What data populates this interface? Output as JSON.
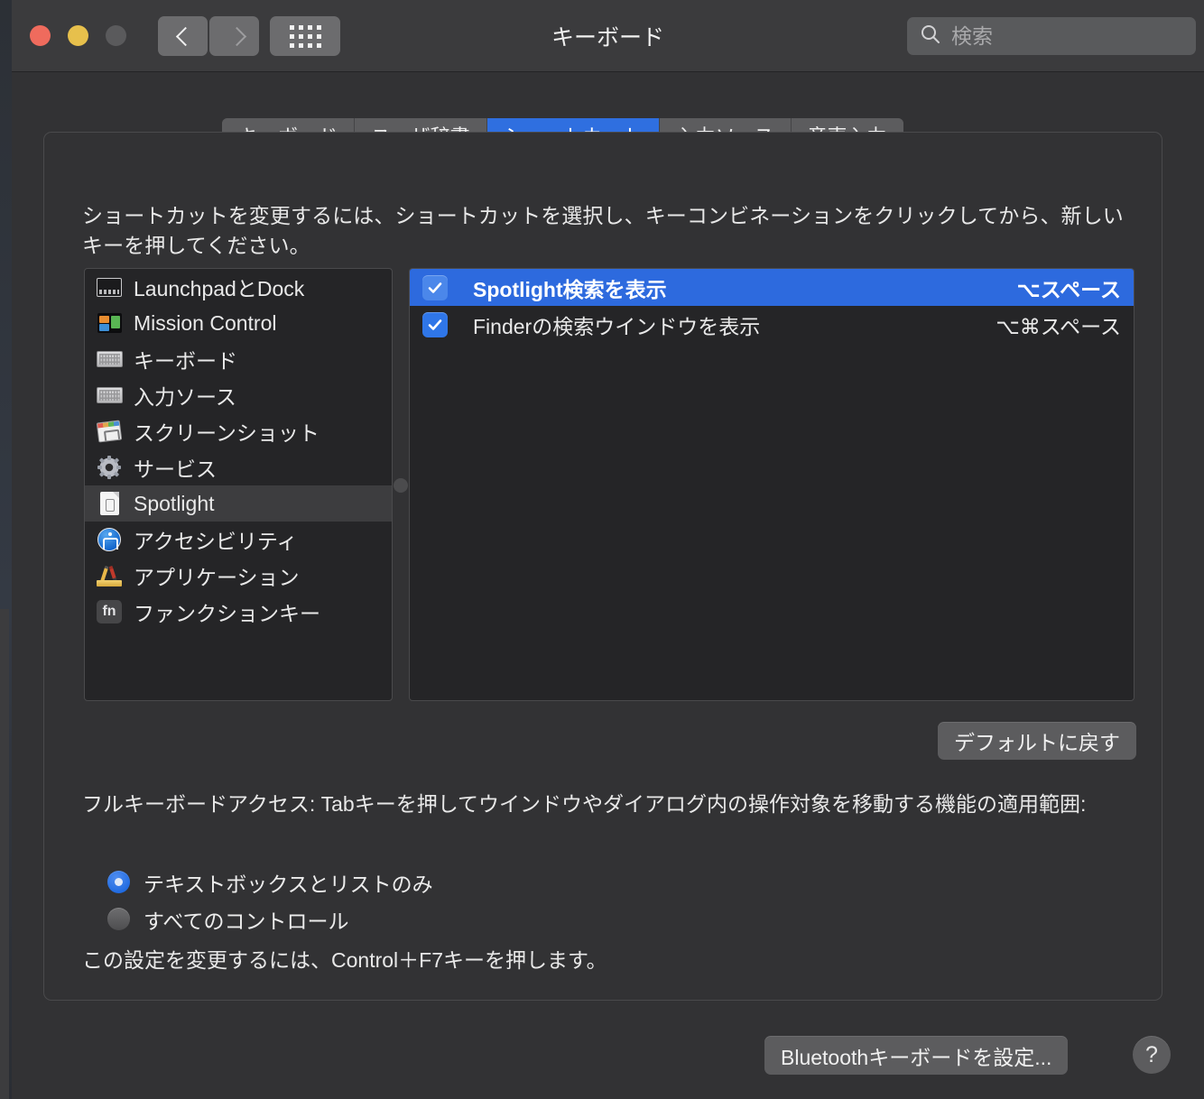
{
  "window": {
    "title": "キーボード",
    "traffic_lights": [
      "close",
      "minimize",
      "zoom"
    ],
    "nav": {
      "back": "back-chevron",
      "forward": "forward-chevron",
      "grid": "show-all-grid"
    },
    "search": {
      "placeholder": "検索",
      "value": "",
      "icon": "search-icon"
    }
  },
  "tabs": [
    {
      "label": "キーボード",
      "active": false
    },
    {
      "label": "ユーザ辞書",
      "active": false
    },
    {
      "label": "ショートカット",
      "active": true
    },
    {
      "label": "入力ソース",
      "active": false
    },
    {
      "label": "音声入力",
      "active": false
    }
  ],
  "description": "ショートカットを変更するには、ショートカットを選択し、キーコンビネーションをクリックしてから、新しいキーを押してください。",
  "categories": [
    {
      "label": "LaunchpadとDock",
      "icon": "launchpad-dock-icon",
      "selected": false
    },
    {
      "label": "Mission Control",
      "icon": "mission-control-icon",
      "selected": false
    },
    {
      "label": "キーボード",
      "icon": "keyboard-icon",
      "selected": false
    },
    {
      "label": "入力ソース",
      "icon": "input-source-icon",
      "selected": false
    },
    {
      "label": "スクリーンショット",
      "icon": "screenshot-icon",
      "selected": false
    },
    {
      "label": "サービス",
      "icon": "services-gear-icon",
      "selected": false
    },
    {
      "label": "Spotlight",
      "icon": "spotlight-doc-icon",
      "selected": true
    },
    {
      "label": "アクセシビリティ",
      "icon": "accessibility-icon",
      "selected": false
    },
    {
      "label": "アプリケーション",
      "icon": "applications-icon",
      "selected": false
    },
    {
      "label": "ファンクションキー",
      "icon": "fn-key-icon",
      "selected": false,
      "icon_text": "fn"
    }
  ],
  "shortcuts": [
    {
      "name": "Spotlight検索を表示",
      "keys": "⌥スペース",
      "checked": true,
      "selected": true
    },
    {
      "name": "Finderの検索ウインドウを表示",
      "keys": "⌥⌘スペース",
      "checked": true,
      "selected": false
    }
  ],
  "restore_defaults_label": "デフォルトに戻す",
  "full_keyboard_access": {
    "description": "フルキーボードアクセス: Tabキーを押してウインドウやダイアログ内の操作対象を移動する機能の適用範囲:",
    "options": [
      {
        "label": "テキストボックスとリストのみ",
        "selected": true
      },
      {
        "label": "すべてのコントロール",
        "selected": false
      }
    ],
    "hint": "この設定を変更するには、Control＋F7キーを押します。"
  },
  "footer": {
    "bluetooth_label": "Bluetoothキーボードを設定...",
    "help_label": "?"
  },
  "colors": {
    "accent_blue": "#2f6fe0",
    "selection_blue": "#2d6ade",
    "window_bg": "#323234",
    "toolbar_bg": "#3b3b3d",
    "list_bg": "#252527",
    "text": "#e9e9e9"
  }
}
